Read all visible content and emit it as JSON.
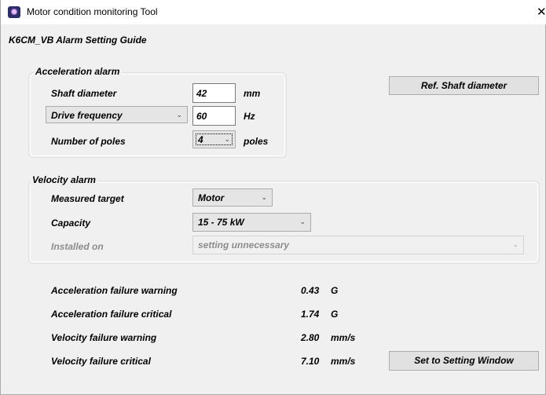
{
  "window": {
    "title": "Motor condition monitoring Tool",
    "close_glyph": "✕"
  },
  "guide_title": "K6CM_VB Alarm Setting Guide",
  "acceleration": {
    "legend": "Acceleration alarm",
    "shaft_label": "Shaft diameter",
    "shaft_value": "42",
    "shaft_unit": "mm",
    "drive_select": "Drive frequency",
    "drive_value": "60",
    "drive_unit": "Hz",
    "poles_label": "Number of poles",
    "poles_value": "4",
    "poles_unit": "poles",
    "ref_button": "Ref. Shaft diameter"
  },
  "velocity": {
    "legend": "Velocity alarm",
    "target_label": "Measured target",
    "target_value": "Motor",
    "capacity_label": "Capacity",
    "capacity_value": "15 - 75 kW",
    "installed_label": "Installed on",
    "installed_value": "setting unnecessary"
  },
  "results": [
    {
      "label": "Acceleration failure warning",
      "value": "0.43",
      "unit": "G"
    },
    {
      "label": "Acceleration failure critical",
      "value": "1.74",
      "unit": "G"
    },
    {
      "label": "Velocity failure warning",
      "value": "2.80",
      "unit": "mm/s"
    },
    {
      "label": "Velocity failure critical",
      "value": "7.10",
      "unit": "mm/s"
    }
  ],
  "set_button": "Set to Setting Window",
  "dropdown_arrow": "⌄",
  "icons": {
    "app": "app-icon",
    "close": "close-icon",
    "dropdown": "chevron-down-icon"
  }
}
